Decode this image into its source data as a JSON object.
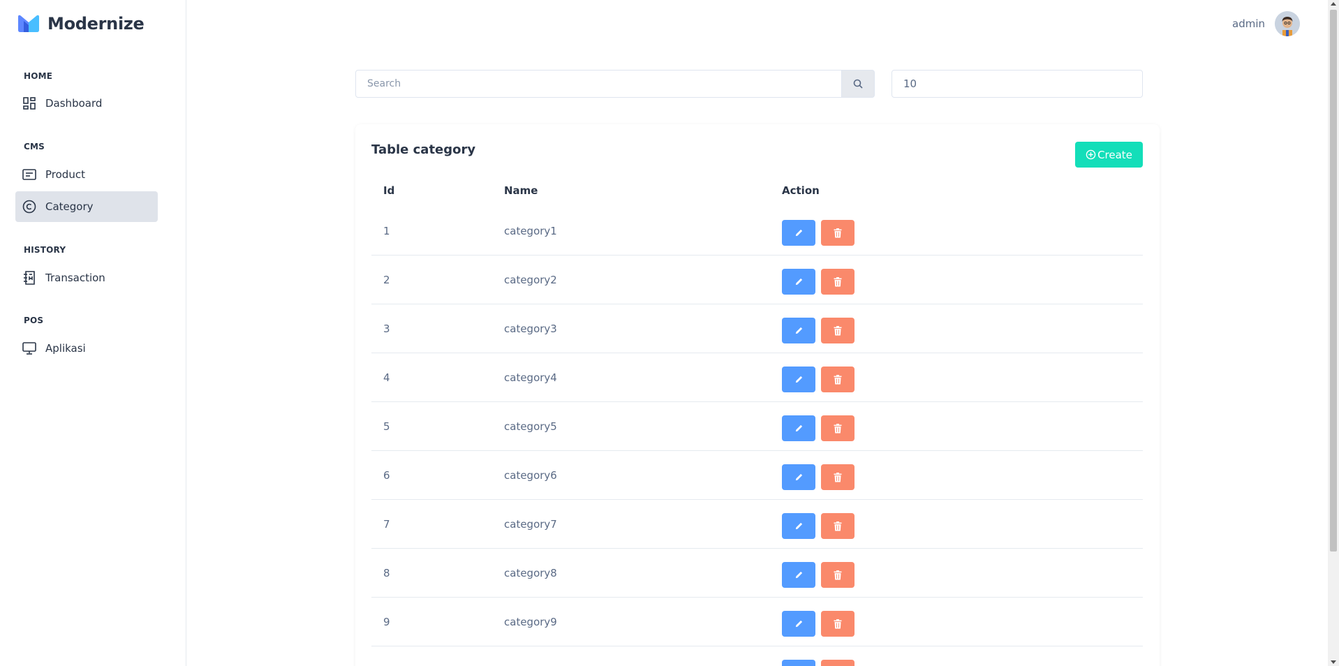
{
  "brand": {
    "name": "Modernize"
  },
  "sidebar": {
    "sections": [
      {
        "caption": "HOME",
        "items": [
          {
            "label": "Dashboard",
            "icon": "dashboard-icon"
          }
        ]
      },
      {
        "caption": "CMS",
        "items": [
          {
            "label": "Product",
            "icon": "product-icon"
          },
          {
            "label": "Category",
            "icon": "copyright-icon",
            "active": true
          }
        ]
      },
      {
        "caption": "HISTORY",
        "items": [
          {
            "label": "Transaction",
            "icon": "receipt-icon"
          }
        ]
      },
      {
        "caption": "POS",
        "items": [
          {
            "label": "Aplikasi",
            "icon": "monitor-icon"
          }
        ]
      }
    ]
  },
  "header": {
    "user_name": "admin"
  },
  "search": {
    "placeholder": "Search",
    "value": "",
    "per_page": "10"
  },
  "card": {
    "title": "Table category",
    "create_label": "Create",
    "columns": [
      "Id",
      "Name",
      "Action"
    ],
    "rows": [
      {
        "id": "1",
        "name": "category1"
      },
      {
        "id": "2",
        "name": "category2"
      },
      {
        "id": "3",
        "name": "category3"
      },
      {
        "id": "4",
        "name": "category4"
      },
      {
        "id": "5",
        "name": "category5"
      },
      {
        "id": "6",
        "name": "category6"
      },
      {
        "id": "7",
        "name": "category7"
      },
      {
        "id": "8",
        "name": "category8"
      },
      {
        "id": "9",
        "name": "category9"
      },
      {
        "id": "",
        "name": ""
      }
    ]
  },
  "colors": {
    "primary": "#539bff",
    "danger": "#fa896b",
    "success": "#13deb9",
    "active_bg": "#dfe3ea"
  }
}
